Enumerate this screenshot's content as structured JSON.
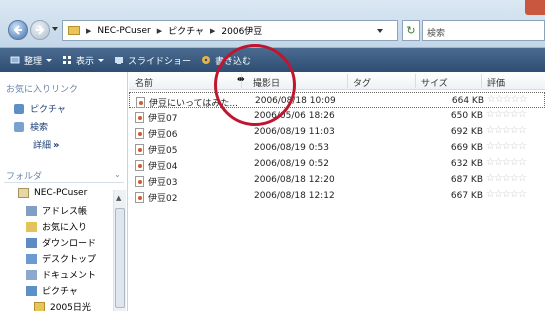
{
  "address_bar": {
    "crumbs": [
      "NEC-PCuser",
      "ピクチャ",
      "2006伊豆"
    ],
    "search_placeholder": "検索"
  },
  "toolbar": {
    "organize_label": "整理",
    "view_label": "表示",
    "slideshow_label": "スライドショー",
    "burn_label": "書き込む"
  },
  "sidebar": {
    "favorites_title": "お気に入りリンク",
    "favorites": [
      {
        "label": "ピクチャ",
        "icon": "pictures-icon"
      },
      {
        "label": "検索",
        "icon": "search-folder-icon"
      }
    ],
    "details_label": "詳細",
    "details_chevron": "»",
    "folders_title": "フォルダ",
    "tree": [
      {
        "label": "NEC-PCuser",
        "icon": "user-folder-icon"
      },
      {
        "label": "アドレス帳",
        "icon": "contacts-icon"
      },
      {
        "label": "お気に入り",
        "icon": "favorites-icon"
      },
      {
        "label": "ダウンロード",
        "icon": "downloads-icon"
      },
      {
        "label": "デスクトップ",
        "icon": "desktop-icon"
      },
      {
        "label": "ドキュメント",
        "icon": "documents-icon"
      },
      {
        "label": "ピクチャ",
        "icon": "pictures-icon"
      },
      {
        "label": "2005日光",
        "icon": "folder-icon"
      }
    ]
  },
  "file_list": {
    "columns": {
      "name": "名前",
      "date_taken": "撮影日",
      "tags": "タグ",
      "size": "サイズ",
      "rating": "評価"
    },
    "rows": [
      {
        "name": "伊豆にいってはみた...",
        "date": "2006/08/18 10:09",
        "size": "664 KB"
      },
      {
        "name": "伊豆07",
        "date": "2006/05/06 18:26",
        "size": "650 KB"
      },
      {
        "name": "伊豆06",
        "date": "2006/08/19 11:03",
        "size": "692 KB"
      },
      {
        "name": "伊豆05",
        "date": "2006/08/19 0:53",
        "size": "669 KB"
      },
      {
        "name": "伊豆04",
        "date": "2006/08/19 0:52",
        "size": "632 KB"
      },
      {
        "name": "伊豆03",
        "date": "2006/08/18 12:20",
        "size": "687 KB"
      },
      {
        "name": "伊豆02",
        "date": "2006/08/18 12:12",
        "size": "667 KB"
      }
    ],
    "rating_stars": "☆☆☆☆☆"
  },
  "colors": {
    "toolbar": "#2e4d72",
    "annotation_circle": "#c0152f",
    "link_text": "#1b3f76"
  }
}
